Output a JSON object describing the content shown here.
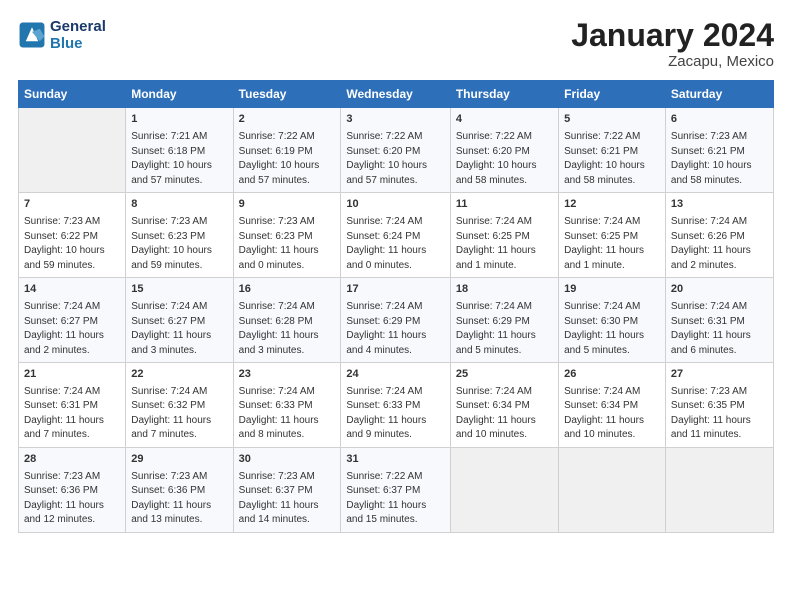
{
  "header": {
    "logo_line1": "General",
    "logo_line2": "Blue",
    "month": "January 2024",
    "location": "Zacapu, Mexico"
  },
  "weekdays": [
    "Sunday",
    "Monday",
    "Tuesday",
    "Wednesday",
    "Thursday",
    "Friday",
    "Saturday"
  ],
  "weeks": [
    [
      {
        "day": "",
        "info": ""
      },
      {
        "day": "1",
        "info": "Sunrise: 7:21 AM\nSunset: 6:18 PM\nDaylight: 10 hours and 57 minutes."
      },
      {
        "day": "2",
        "info": "Sunrise: 7:22 AM\nSunset: 6:19 PM\nDaylight: 10 hours and 57 minutes."
      },
      {
        "day": "3",
        "info": "Sunrise: 7:22 AM\nSunset: 6:20 PM\nDaylight: 10 hours and 57 minutes."
      },
      {
        "day": "4",
        "info": "Sunrise: 7:22 AM\nSunset: 6:20 PM\nDaylight: 10 hours and 58 minutes."
      },
      {
        "day": "5",
        "info": "Sunrise: 7:22 AM\nSunset: 6:21 PM\nDaylight: 10 hours and 58 minutes."
      },
      {
        "day": "6",
        "info": "Sunrise: 7:23 AM\nSunset: 6:21 PM\nDaylight: 10 hours and 58 minutes."
      }
    ],
    [
      {
        "day": "7",
        "info": "Sunrise: 7:23 AM\nSunset: 6:22 PM\nDaylight: 10 hours and 59 minutes."
      },
      {
        "day": "8",
        "info": "Sunrise: 7:23 AM\nSunset: 6:23 PM\nDaylight: 10 hours and 59 minutes."
      },
      {
        "day": "9",
        "info": "Sunrise: 7:23 AM\nSunset: 6:23 PM\nDaylight: 11 hours and 0 minutes."
      },
      {
        "day": "10",
        "info": "Sunrise: 7:24 AM\nSunset: 6:24 PM\nDaylight: 11 hours and 0 minutes."
      },
      {
        "day": "11",
        "info": "Sunrise: 7:24 AM\nSunset: 6:25 PM\nDaylight: 11 hours and 1 minute."
      },
      {
        "day": "12",
        "info": "Sunrise: 7:24 AM\nSunset: 6:25 PM\nDaylight: 11 hours and 1 minute."
      },
      {
        "day": "13",
        "info": "Sunrise: 7:24 AM\nSunset: 6:26 PM\nDaylight: 11 hours and 2 minutes."
      }
    ],
    [
      {
        "day": "14",
        "info": "Sunrise: 7:24 AM\nSunset: 6:27 PM\nDaylight: 11 hours and 2 minutes."
      },
      {
        "day": "15",
        "info": "Sunrise: 7:24 AM\nSunset: 6:27 PM\nDaylight: 11 hours and 3 minutes."
      },
      {
        "day": "16",
        "info": "Sunrise: 7:24 AM\nSunset: 6:28 PM\nDaylight: 11 hours and 3 minutes."
      },
      {
        "day": "17",
        "info": "Sunrise: 7:24 AM\nSunset: 6:29 PM\nDaylight: 11 hours and 4 minutes."
      },
      {
        "day": "18",
        "info": "Sunrise: 7:24 AM\nSunset: 6:29 PM\nDaylight: 11 hours and 5 minutes."
      },
      {
        "day": "19",
        "info": "Sunrise: 7:24 AM\nSunset: 6:30 PM\nDaylight: 11 hours and 5 minutes."
      },
      {
        "day": "20",
        "info": "Sunrise: 7:24 AM\nSunset: 6:31 PM\nDaylight: 11 hours and 6 minutes."
      }
    ],
    [
      {
        "day": "21",
        "info": "Sunrise: 7:24 AM\nSunset: 6:31 PM\nDaylight: 11 hours and 7 minutes."
      },
      {
        "day": "22",
        "info": "Sunrise: 7:24 AM\nSunset: 6:32 PM\nDaylight: 11 hours and 7 minutes."
      },
      {
        "day": "23",
        "info": "Sunrise: 7:24 AM\nSunset: 6:33 PM\nDaylight: 11 hours and 8 minutes."
      },
      {
        "day": "24",
        "info": "Sunrise: 7:24 AM\nSunset: 6:33 PM\nDaylight: 11 hours and 9 minutes."
      },
      {
        "day": "25",
        "info": "Sunrise: 7:24 AM\nSunset: 6:34 PM\nDaylight: 11 hours and 10 minutes."
      },
      {
        "day": "26",
        "info": "Sunrise: 7:24 AM\nSunset: 6:34 PM\nDaylight: 11 hours and 10 minutes."
      },
      {
        "day": "27",
        "info": "Sunrise: 7:23 AM\nSunset: 6:35 PM\nDaylight: 11 hours and 11 minutes."
      }
    ],
    [
      {
        "day": "28",
        "info": "Sunrise: 7:23 AM\nSunset: 6:36 PM\nDaylight: 11 hours and 12 minutes."
      },
      {
        "day": "29",
        "info": "Sunrise: 7:23 AM\nSunset: 6:36 PM\nDaylight: 11 hours and 13 minutes."
      },
      {
        "day": "30",
        "info": "Sunrise: 7:23 AM\nSunset: 6:37 PM\nDaylight: 11 hours and 14 minutes."
      },
      {
        "day": "31",
        "info": "Sunrise: 7:22 AM\nSunset: 6:37 PM\nDaylight: 11 hours and 15 minutes."
      },
      {
        "day": "",
        "info": ""
      },
      {
        "day": "",
        "info": ""
      },
      {
        "day": "",
        "info": ""
      }
    ]
  ]
}
